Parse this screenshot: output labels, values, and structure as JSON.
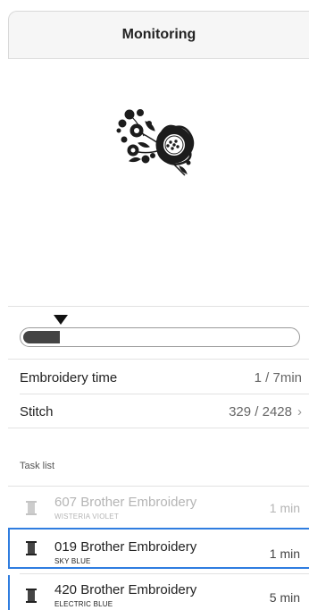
{
  "header": {
    "title": "Monitoring"
  },
  "progress": {
    "fraction": 0.135
  },
  "info_rows": [
    {
      "label": "Embroidery time",
      "value": "1 / 7min"
    },
    {
      "label": "Stitch",
      "value": "329 / 2428"
    }
  ],
  "task_list": {
    "label": "Task list",
    "items": [
      {
        "name": "607 Brother Embroidery",
        "color": "WISTERIA VIOLET",
        "time": "1 min",
        "state": "dim"
      },
      {
        "name": "019 Brother Embroidery",
        "color": "SKY BLUE",
        "time": "1 min",
        "state": "selected"
      },
      {
        "name": "420 Brother Embroidery",
        "color": "ELECTRIC BLUE",
        "time": "5 min",
        "state": "normal"
      }
    ]
  }
}
